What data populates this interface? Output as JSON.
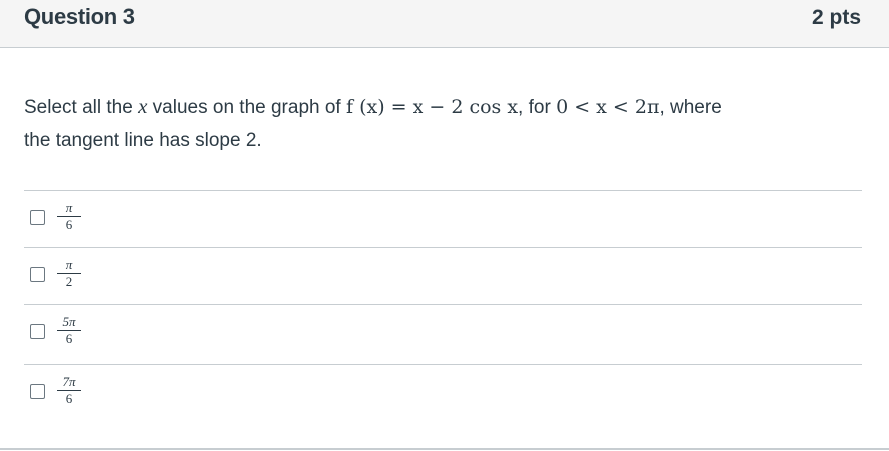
{
  "header": {
    "title": "Question 3",
    "points": "2 pts"
  },
  "prompt": {
    "text_1": "Select all the ",
    "var_x": "x",
    "text_2": " values on the graph of ",
    "func": "f (x) = x − 2 cos x",
    "text_3": ", for ",
    "interval": "0 < x < 2π",
    "text_4": ", where",
    "line_2": "the tangent line has slope 2."
  },
  "answers": [
    {
      "numerator": "π",
      "denominator": "6"
    },
    {
      "numerator": "π",
      "denominator": "2"
    },
    {
      "numerator": "5π",
      "denominator": "6"
    },
    {
      "numerator": "7π",
      "denominator": "6"
    }
  ]
}
